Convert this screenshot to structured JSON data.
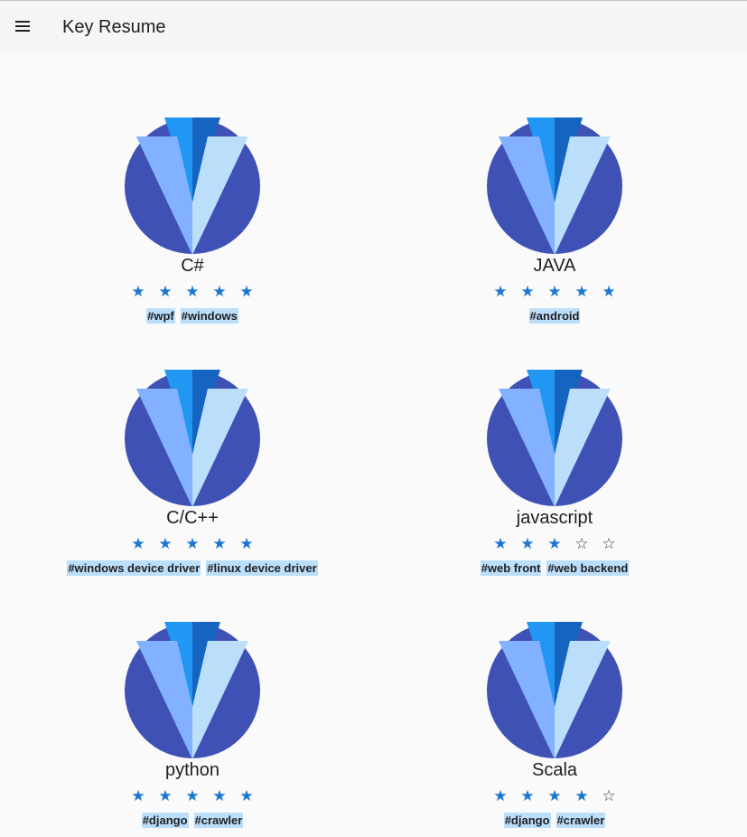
{
  "header": {
    "title": "Key Resume",
    "menu_icon": "menu-icon"
  },
  "colors": {
    "accent": "#1976d2",
    "tag_background": "#bbdefb",
    "toolbar": "#f5f5f5",
    "logo_circle": "#3f51b5",
    "logo_light": "#82b1ff"
  },
  "skills": [
    {
      "name": "C#",
      "rating": 5,
      "max_rating": 5,
      "tags": [
        "#wpf",
        "#windows"
      ]
    },
    {
      "name": "JAVA",
      "rating": 5,
      "max_rating": 5,
      "tags": [
        "#android"
      ]
    },
    {
      "name": "C/C++",
      "rating": 5,
      "max_rating": 5,
      "tags": [
        "#windows device driver",
        "#linux device driver"
      ]
    },
    {
      "name": "javascript",
      "rating": 3,
      "max_rating": 5,
      "tags": [
        "#web front",
        "#web backend"
      ]
    },
    {
      "name": "python",
      "rating": 5,
      "max_rating": 5,
      "tags": [
        "#django",
        "#crawler"
      ]
    },
    {
      "name": "Scala",
      "rating": 4,
      "max_rating": 5,
      "tags": [
        "#django",
        "#crawler"
      ]
    }
  ]
}
